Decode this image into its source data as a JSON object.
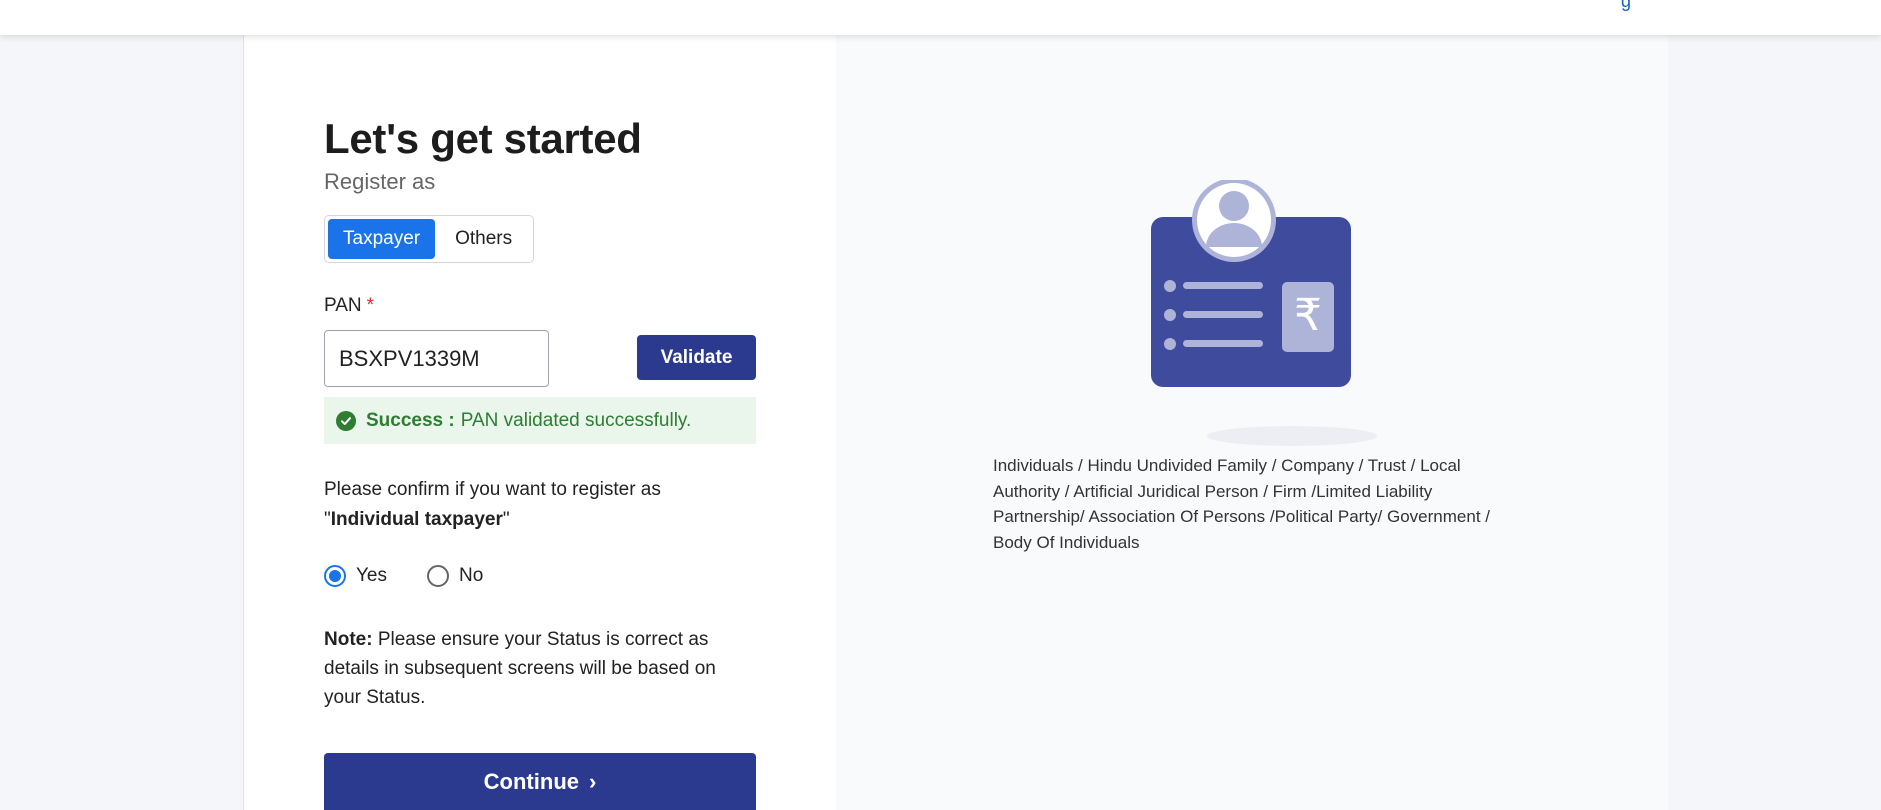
{
  "header": {
    "link_fragment": "g"
  },
  "form": {
    "heading": "Let's get started",
    "subheading": "Register as",
    "toggle": {
      "options": [
        "Taxpayer",
        "Others"
      ],
      "selected": "Taxpayer"
    },
    "pan": {
      "label": "PAN",
      "required_mark": "*",
      "value": "BSXPV1339M",
      "validate_label": "Validate"
    },
    "success": {
      "title": "Success :",
      "message": "PAN validated successfully."
    },
    "confirm": {
      "prefix": "Please confirm if you want to register as \"",
      "entity": "Individual taxpayer",
      "suffix": "\""
    },
    "radio": {
      "yes_label": "Yes",
      "no_label": "No",
      "selected": "Yes"
    },
    "note": {
      "label": "Note:",
      "text": " Please ensure your Status is correct as details in subsequent screens will be based on your Status."
    },
    "continue_label": "Continue",
    "continue_icon": "chevron-right-icon"
  },
  "sidebar": {
    "illustration_icon": "id-card-rupee-icon",
    "entities_text": "Individuals / Hindu Undivided Family / Company / Trust / Local Authority / Artificial Juridical Person / Firm /Limited Liability Partnership/ Association Of Persons /Political Party/ Government / Body Of Individuals"
  },
  "colors": {
    "primary": "#2b3a8f",
    "accent": "#1a73e8",
    "success": "#2e7d32",
    "success_bg": "#eaf5ec",
    "required": "#d32f2f"
  }
}
